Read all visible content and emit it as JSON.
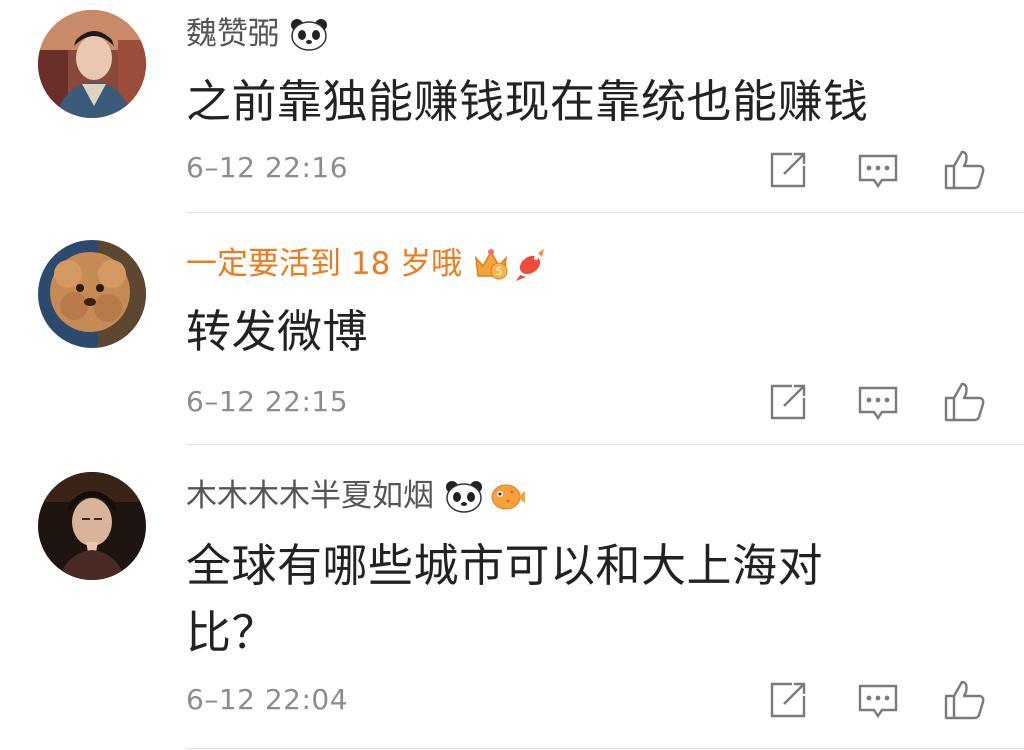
{
  "comments": [
    {
      "username": "魏赞弼",
      "content": "之前靠独能赚钱现在靠统也能赚钱",
      "time": "6–12 22:16",
      "badges": [
        "panda-badge-icon"
      ]
    },
    {
      "username": "一定要活到 18 岁哦",
      "content": "转发微博",
      "time": "6–12 22:15",
      "badges": [
        "crown-level-5-badge-icon",
        "koi-fish-badge-icon"
      ]
    },
    {
      "username": "木木木木半夏如烟",
      "content_lines": [
        "全球有哪些城市可以和大上海对",
        "比？"
      ],
      "time": "6–12 22:04",
      "badges": [
        "panda-badge-icon",
        "pufferfish-badge-icon"
      ]
    }
  ],
  "crown_badge_level": "5",
  "colors": {
    "vip_name": "#f07a1a",
    "name": "#555555",
    "text": "#222222",
    "meta": "#8c8c8c",
    "icon": "#7a7a7a"
  },
  "action_icons": [
    "repost-icon",
    "comment-icon",
    "like-icon"
  ]
}
